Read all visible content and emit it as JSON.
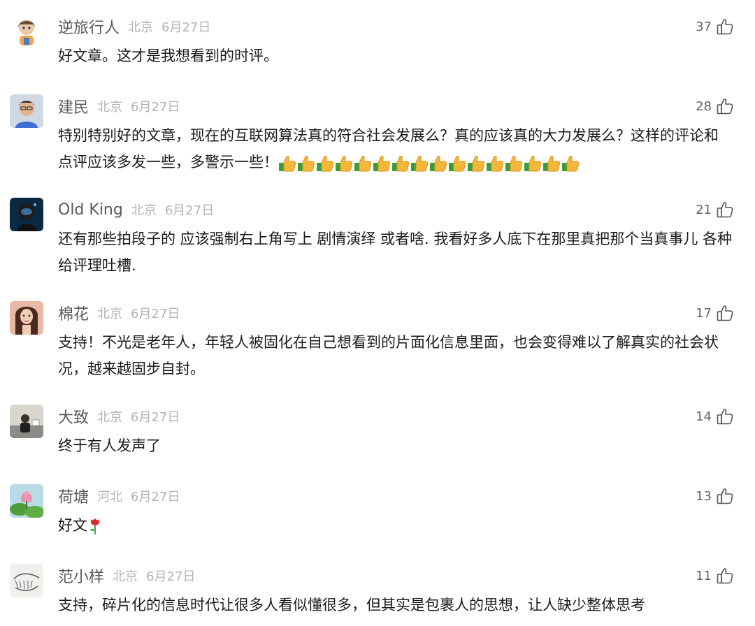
{
  "comments": [
    {
      "name": "逆旅行人",
      "location": "北京",
      "date": "6月27日",
      "likes": "37",
      "text": "好文章。这才是我想看到的时评。"
    },
    {
      "name": "建民",
      "location": "北京",
      "date": "6月27日",
      "likes": "28",
      "text": "特别特别好的文章，现在的互联网算法真的符合社会发展么？真的应该真的大力发展么？这样的评论和点评应该多发一些，多警示一些！",
      "emoji": "👍👍👍👍👍👍👍👍👍👍👍👍👍👍👍👍"
    },
    {
      "name": "Old King",
      "location": "北京",
      "date": "6月27日",
      "likes": "21",
      "text": "还有那些拍段子的 应该强制右上角写上 剧情演绎 或者啥. 我看好多人底下在那里真把那个当真事儿 各种给评理吐槽."
    },
    {
      "name": "棉花",
      "location": "北京",
      "date": "6月27日",
      "likes": "17",
      "text": "支持！不光是老年人，年轻人被固化在自己想看到的片面化信息里面，也会变得难以了解真实的社会状况，越来越固步自封。"
    },
    {
      "name": "大致",
      "location": "北京",
      "date": "6月27日",
      "likes": "14",
      "text": "终于有人发声了"
    },
    {
      "name": "荷塘",
      "location": "河北",
      "date": "6月27日",
      "likes": "13",
      "text": "好文",
      "emoji": "🌹"
    },
    {
      "name": "范小样",
      "location": "北京",
      "date": "6月27日",
      "likes": "11",
      "text": "支持，碎片化的信息时代让很多人看似懂很多，但其实是包裹人的思想，让人缺少整体思考"
    }
  ],
  "icons": {
    "like": "thumbs-up-outline-icon"
  }
}
